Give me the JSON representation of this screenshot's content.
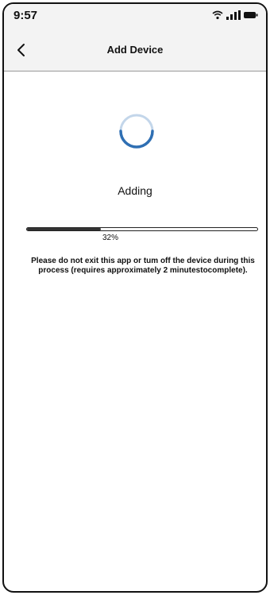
{
  "status_bar": {
    "time": "9:57",
    "icons": [
      "wifi-icon",
      "signal-icon",
      "battery-icon"
    ]
  },
  "header": {
    "title": "Add Device",
    "back_icon": "chevron-left-icon"
  },
  "main": {
    "spinner_icon": "loading-spinner-icon",
    "status": "Adding",
    "progress": {
      "value": 0.32,
      "label": "32%"
    },
    "note": "Please do not exit this app or tum off the device during this process (requires approximately 2 minutestocomplete)."
  },
  "colors": {
    "accent": "#2f6fb3",
    "background": "#ffffff",
    "bar_background": "#f3f3f3"
  }
}
